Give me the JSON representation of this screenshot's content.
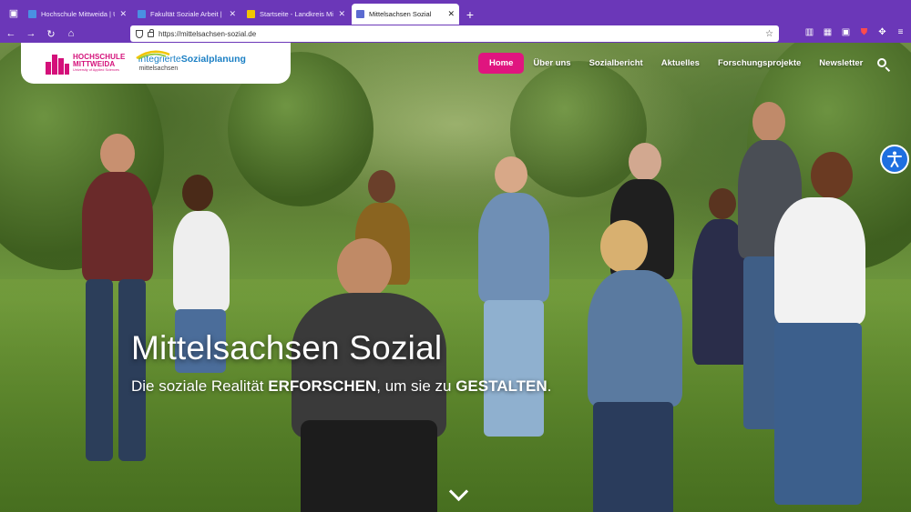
{
  "browser": {
    "tabs": [
      {
        "title": "Hochschule Mittweida | Univers",
        "favicon_color": "#4a90e2",
        "active": false
      },
      {
        "title": "Fakultät Soziale Arbeit | HS Mitt",
        "favicon_color": "#4a90e2",
        "active": false
      },
      {
        "title": "Startseite - Landkreis Mittelsach",
        "favicon_color": "#f2c500",
        "active": false
      },
      {
        "title": "Mittelsachsen Sozial",
        "favicon_color": "#5b6bd1",
        "active": true
      }
    ],
    "url": "https://mittelsachsen-sozial.de",
    "close_glyph": "✕",
    "newtab_glyph": "+"
  },
  "site": {
    "logos": {
      "hsm_line1": "HOCHSCHULE",
      "hsm_line2": "MITTWEIDA",
      "hsm_tagline": "University of Applied Sciences",
      "isp_prefix": "Integrierte",
      "isp_strong": "Sozialplanung",
      "isp_region": "mittelsachsen"
    },
    "nav": [
      {
        "label": "Home",
        "active": true
      },
      {
        "label": "Über uns",
        "active": false
      },
      {
        "label": "Sozialbericht",
        "active": false
      },
      {
        "label": "Aktuelles",
        "active": false
      },
      {
        "label": "Forschungsprojekte",
        "active": false
      },
      {
        "label": "Newsletter",
        "active": false
      }
    ],
    "hero": {
      "title": "Mittelsachsen Sozial",
      "subtitle_part1": "Die soziale Realität ",
      "subtitle_strong1": "ERFORSCHEN",
      "subtitle_part2": ", um sie zu ",
      "subtitle_strong2": "GESTALTEN",
      "subtitle_part3": "."
    },
    "colors": {
      "brand_magenta": "#e0157f",
      "browser_purple": "#6b37b8",
      "a11y_blue": "#1e6fe0"
    },
    "icons": [
      "search-icon",
      "accessibility-icon",
      "chevron-down-icon"
    ]
  }
}
